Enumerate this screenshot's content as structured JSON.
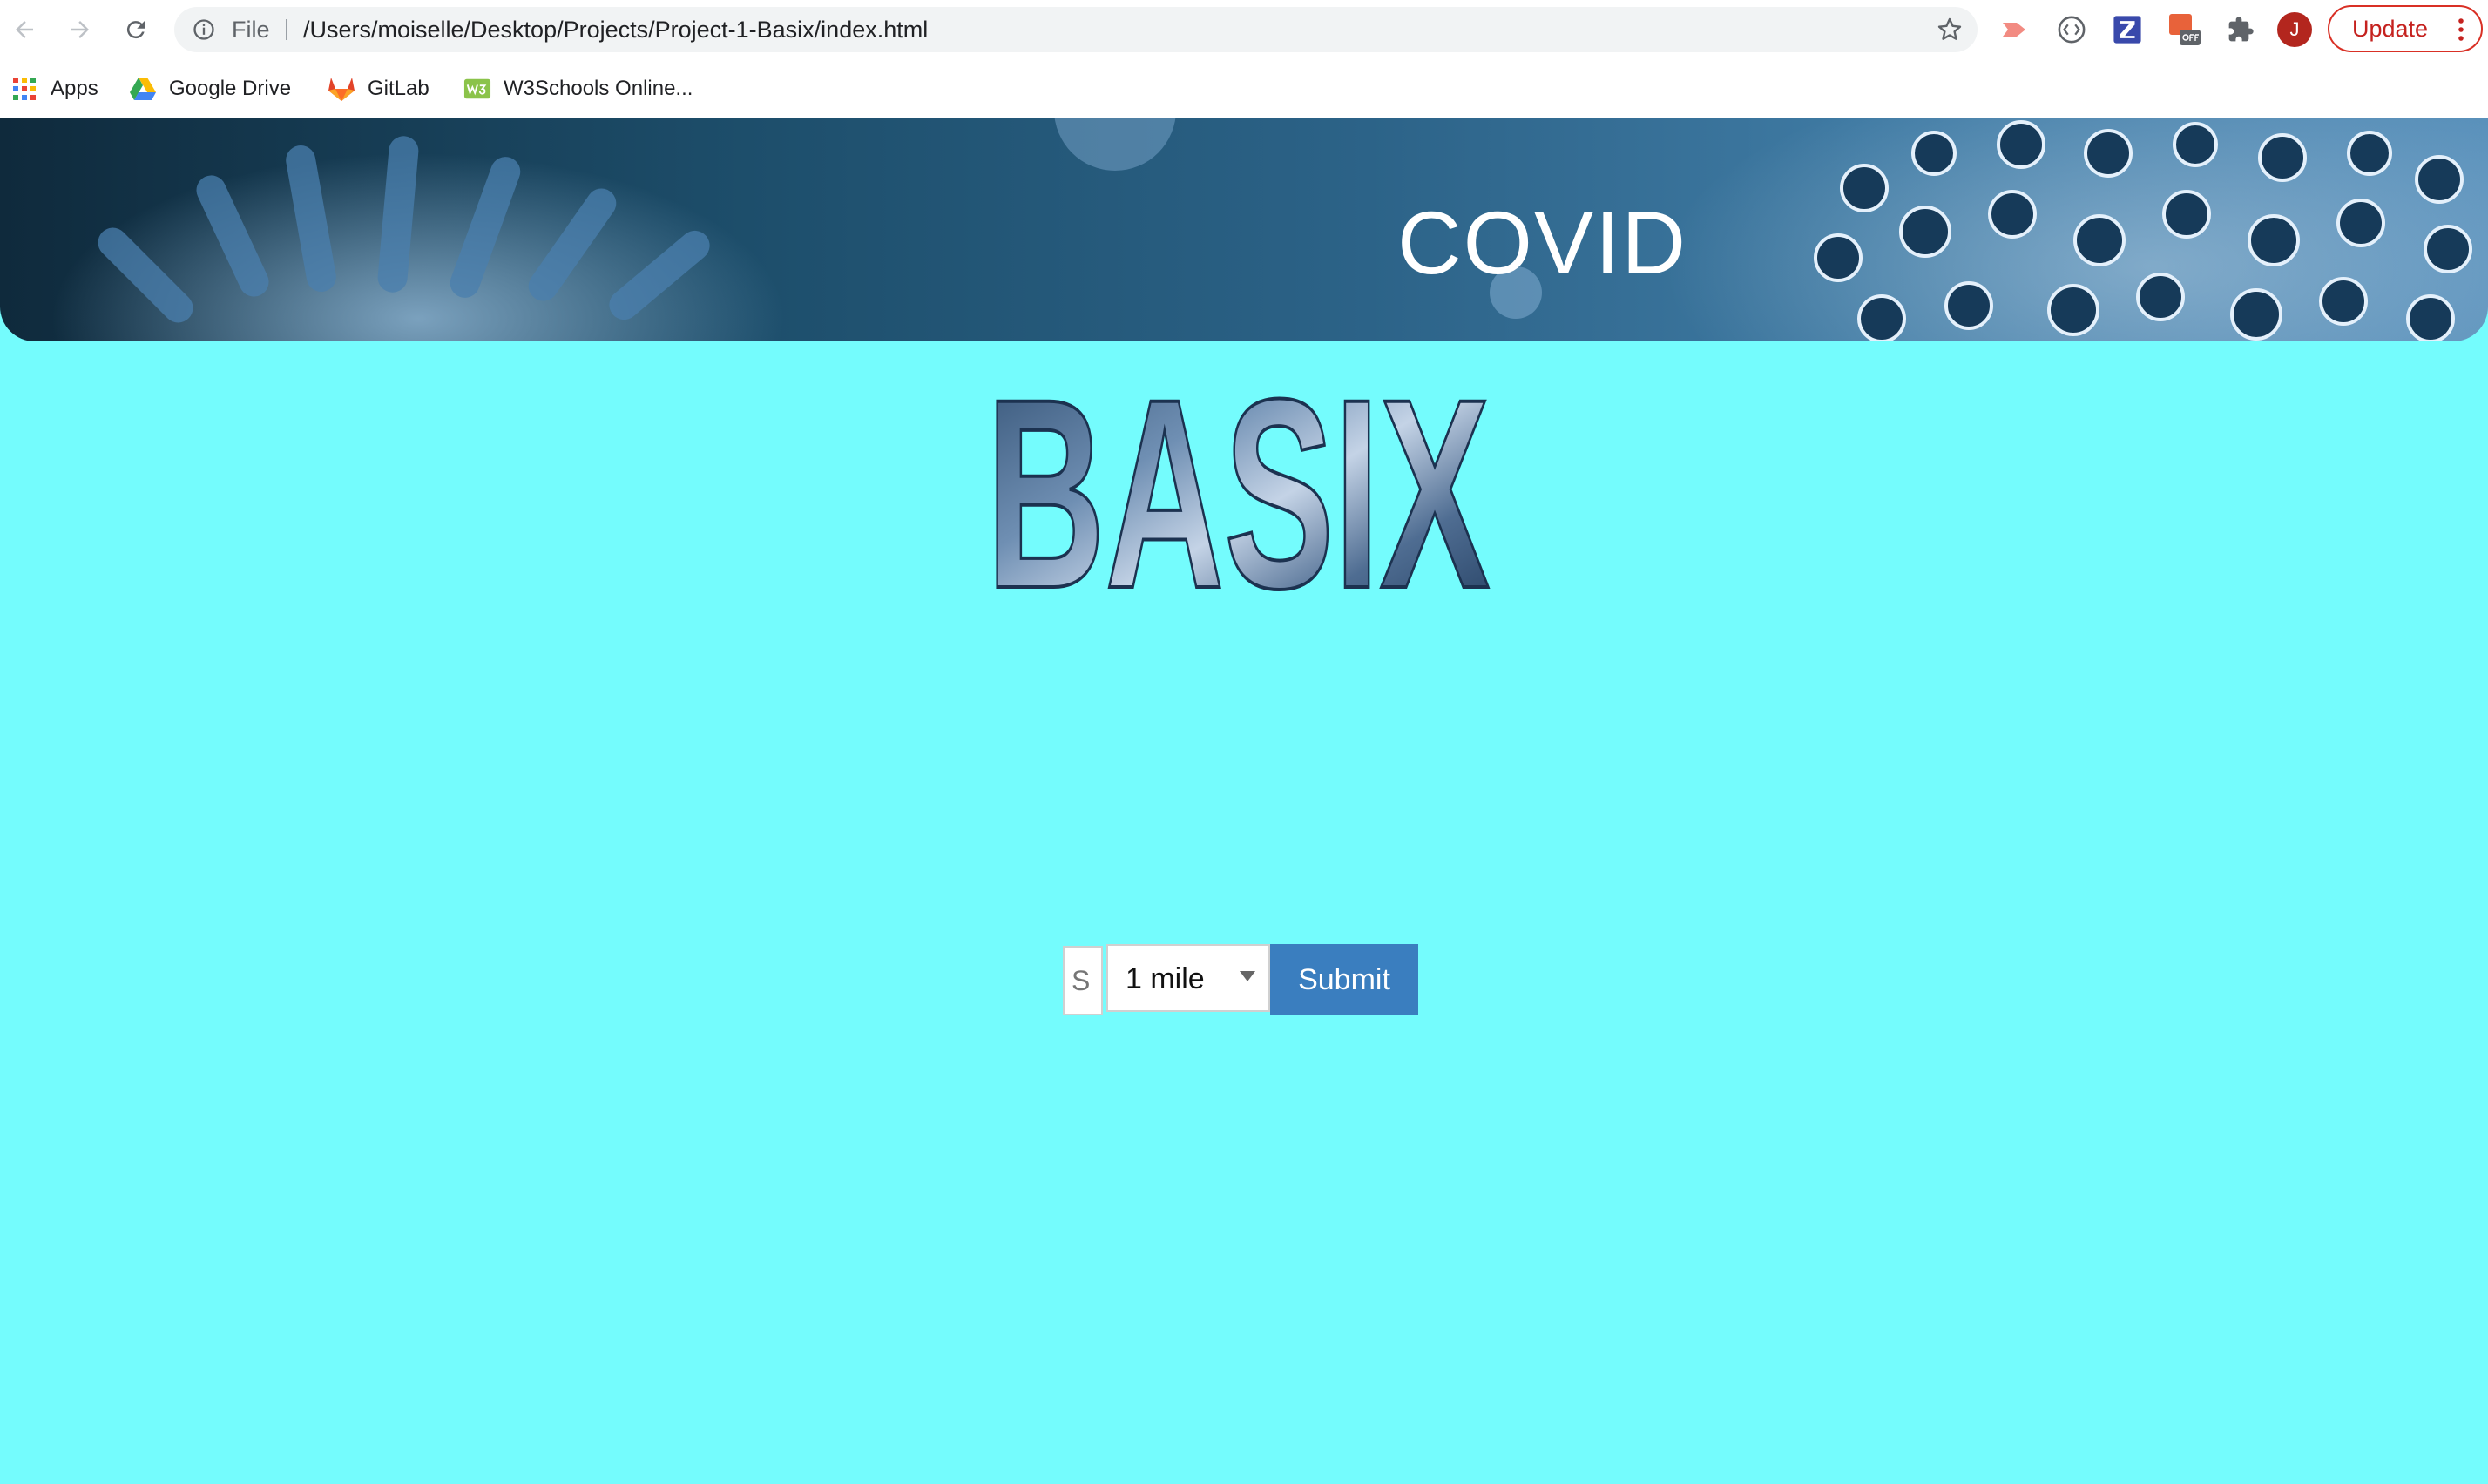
{
  "browser": {
    "omnibox": {
      "scheme_label": "File",
      "url": "/Users/moiselle/Desktop/Projects/Project-1-Basix/index.html"
    },
    "avatar_initial": "J",
    "update_label": "Update",
    "icons": [
      "back-icon",
      "forward-icon",
      "reload-icon",
      "info-icon",
      "star-icon",
      "extension-icons",
      "puzzle-icon",
      "kebab-icon"
    ]
  },
  "bookmarks": [
    {
      "label": "Apps",
      "icon": "apps-grid-icon"
    },
    {
      "label": "Google Drive",
      "icon": "google-drive-icon"
    },
    {
      "label": "GitLab",
      "icon": "gitlab-icon"
    },
    {
      "label": "W3Schools Online...",
      "icon": "w3schools-icon"
    }
  ],
  "page": {
    "banner_title": "COVID",
    "logo_text": "BASIX",
    "search": {
      "placeholder": "S",
      "radius_selected": "1 mile",
      "submit_label": "Submit"
    }
  },
  "colors": {
    "page_background": "#74fcfd",
    "submit_button": "#3a7ebf",
    "banner_dark": "#0f2a3c",
    "banner_light": "#5a91bb"
  }
}
